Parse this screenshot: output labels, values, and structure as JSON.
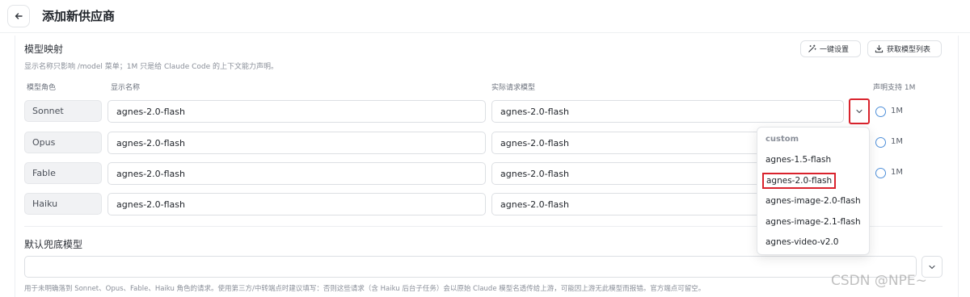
{
  "header": {
    "title": "添加新供应商",
    "back_icon": "arrow-left-icon"
  },
  "mapping": {
    "title": "模型映射",
    "description": "显示名称只影响 /model 菜单；1M 只是给 Claude Code 的上下文能力声明。",
    "one_click_label": "一键设置",
    "fetch_models_label": "获取模型列表",
    "columns": {
      "role": "模型角色",
      "display_name": "显示名称",
      "actual_model": "实际请求模型",
      "declare_1m": "声明支持 1M"
    },
    "rows": [
      {
        "role": "Sonnet",
        "display_name": "agnes-2.0-flash",
        "actual_model": "agnes-2.0-flash",
        "one_m": "1M",
        "has_1m": true
      },
      {
        "role": "Opus",
        "display_name": "agnes-2.0-flash",
        "actual_model": "agnes-2.0-flash",
        "one_m": "1M",
        "has_1m": true
      },
      {
        "role": "Fable",
        "display_name": "agnes-2.0-flash",
        "actual_model": "agnes-2.0-flash",
        "one_m": "1M",
        "has_1m": true
      },
      {
        "role": "Haiku",
        "display_name": "agnes-2.0-flash",
        "actual_model": "agnes-2.0-flash",
        "one_m": "",
        "has_1m": false
      }
    ]
  },
  "dropdown": {
    "header": "custom",
    "options": [
      "agnes-1.5-flash",
      "agnes-2.0-flash",
      "agnes-image-2.0-flash",
      "agnes-image-2.1-flash",
      "agnes-video-v2.0"
    ],
    "selected": "agnes-2.0-flash"
  },
  "fallback": {
    "title": "默认兜底模型",
    "value": "",
    "description": "用于未明确落到 Sonnet、Opus、Fable、Haiku 角色的请求。使用第三方/中转端点时建议填写：否则这些请求（含 Haiku 后台子任务）会以原始 Claude 模型名透传给上游，可能因上游无此模型而报错。官方端点可留空。"
  },
  "watermark": "CSDN @NPE~",
  "colors": {
    "highlight": "#d9232d",
    "radio": "#4e8fd9"
  }
}
